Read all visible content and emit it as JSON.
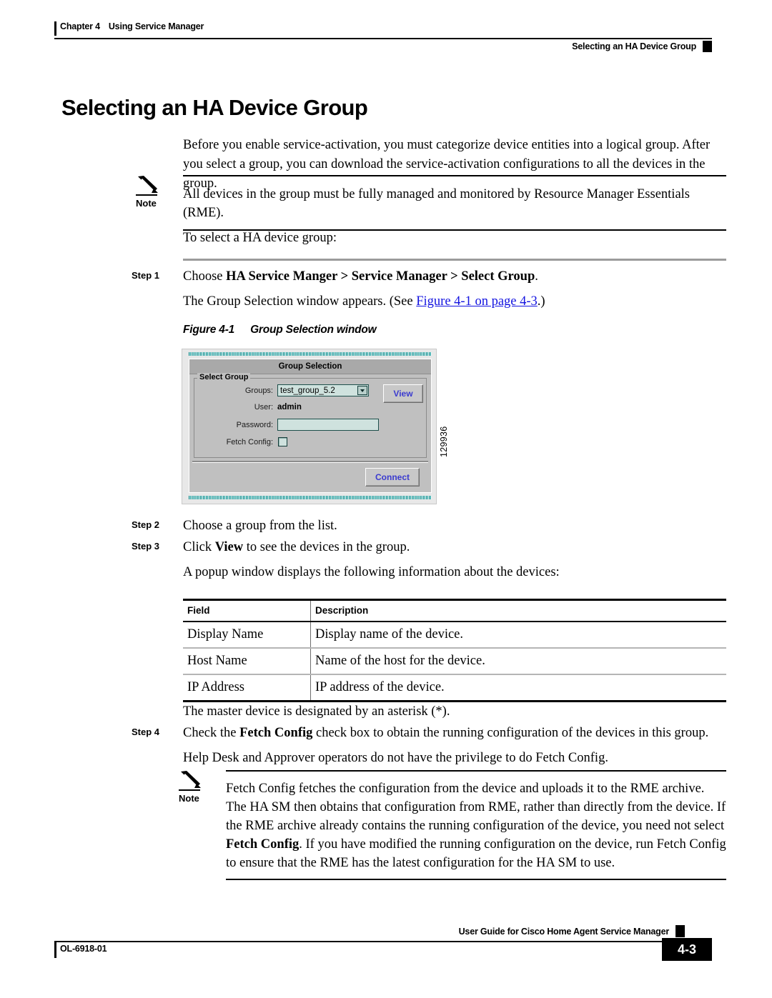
{
  "header": {
    "chapter": "Chapter 4",
    "chapter_title": "Using Service Manager",
    "running_head": "Selecting an HA Device Group"
  },
  "title": "Selecting an HA Device Group",
  "intro": "Before you enable service-activation, you must categorize device entities into a logical group. After you select a group, you can download the service-activation configurations to all the devices in the group.",
  "note1": {
    "label": "Note",
    "icon": "pencil-icon",
    "text": "All devices in the group must be fully managed and monitored by Resource Manager Essentials (RME)."
  },
  "lead_in": "To select a HA device group:",
  "steps": {
    "step1": {
      "label": "Step 1",
      "text_prefix": "Choose ",
      "menu_path": "HA Service Manger > Service Manager > Select Group",
      "text_suffix": ".",
      "followup_prefix": "The Group Selection window appears. (See ",
      "followup_link": "Figure 4-1 on page 4-3",
      "followup_suffix": ".)"
    },
    "step2": {
      "label": "Step 2",
      "text": "Choose a group from the list."
    },
    "step3": {
      "label": "Step 3",
      "text_prefix": "Click ",
      "bold": "View",
      "text_suffix": " to see the devices in the group.",
      "followup": "A popup window displays the following information about the devices:"
    },
    "step4": {
      "label": "Step 4",
      "text_prefix": "Check the ",
      "bold": "Fetch Config",
      "text_suffix": " check box to obtain the running configuration of the devices in this group.",
      "followup": "Help Desk and Approver operators do not have the privilege to do Fetch Config."
    }
  },
  "figure": {
    "caption_num": "Figure 4-1",
    "caption_text": "Group Selection window",
    "id_number": "129936",
    "dialog": {
      "title": "Group Selection",
      "fieldset_legend": "Select Group",
      "groups_label": "Groups:",
      "groups_value": "test_group_5.2",
      "dropdown_icon": "chevron-down-icon",
      "view_button": "View",
      "user_label": "User:",
      "user_value": "admin",
      "password_label": "Password:",
      "password_value": "",
      "fetch_config_label": "Fetch Config:",
      "fetch_config_checked": false,
      "connect_button": "Connect"
    }
  },
  "table": {
    "headers": [
      "Field",
      "Description"
    ],
    "rows": [
      [
        "Display Name",
        "Display name of the device."
      ],
      [
        "Host Name",
        "Name of the host for the device."
      ],
      [
        "IP Address",
        "IP address of the device."
      ]
    ]
  },
  "master_note": "The master device is designated by an asterisk (*).",
  "note2": {
    "label": "Note",
    "icon": "pencil-icon",
    "part1": "Fetch Config fetches the configuration from the device and uploads it to the RME archive. The HA SM then obtains that configuration from RME, rather than directly from the device. If the RME archive already contains the running configuration of the device, you need not select ",
    "bold1": "Fetch Config",
    "part2": ". If you have modified the running configuration on the device, run Fetch Config to ensure that the RME has the latest configuration for the HA SM to use."
  },
  "footer": {
    "doc_id": "OL-6918-01",
    "guide_title": "User Guide for Cisco Home Agent Service Manager",
    "page_number": "4-3"
  }
}
